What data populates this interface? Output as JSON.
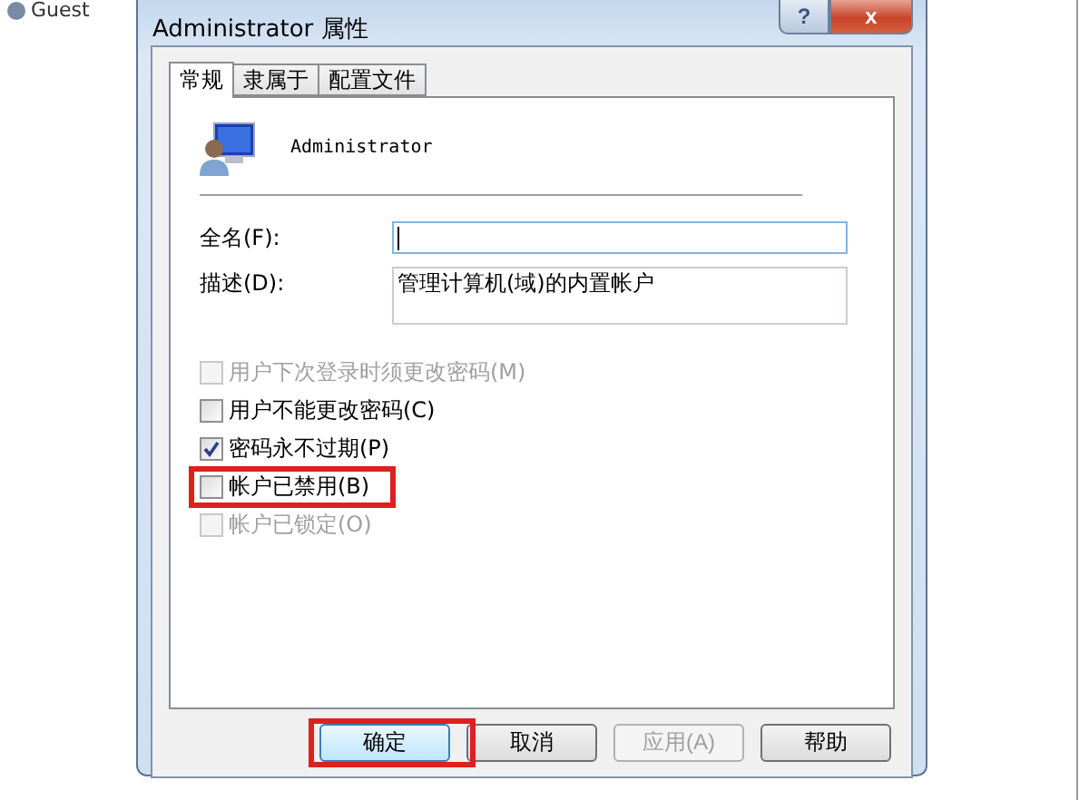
{
  "background_list": {
    "item": "Guest"
  },
  "window": {
    "title": "Administrator 属性",
    "help_button": "?",
    "close_button": "x"
  },
  "tabs": [
    {
      "label": "常规",
      "selected": true
    },
    {
      "label": "隶属于",
      "selected": false
    },
    {
      "label": "配置文件",
      "selected": false
    }
  ],
  "user": {
    "name": "Administrator"
  },
  "fields": [
    {
      "label": "全名(F):",
      "multiline": false
    },
    {
      "label": "描述(D):",
      "value": "管理计算机(域)的内置帐户",
      "multiline": true
    }
  ],
  "checkboxes": [
    {
      "label": "用户下次登录时须更改密码(M)",
      "checked": false,
      "disabled": true,
      "highlighted": false
    },
    {
      "label": "用户不能更改密码(C)",
      "checked": false,
      "disabled": false,
      "highlighted": false
    },
    {
      "label": "密码永不过期(P)",
      "checked": true,
      "disabled": false,
      "highlighted": false
    },
    {
      "label": "帐户已禁用(B)",
      "checked": false,
      "disabled": false,
      "highlighted": true
    },
    {
      "label": "帐户已锁定(O)",
      "checked": false,
      "disabled": true,
      "highlighted": false
    }
  ],
  "buttons": [
    {
      "label": "确定",
      "default": true,
      "disabled": false,
      "highlighted": true
    },
    {
      "label": "取消",
      "default": false,
      "disabled": false,
      "highlighted": false
    },
    {
      "label": "应用(A)",
      "default": false,
      "disabled": true,
      "highlighted": false
    },
    {
      "label": "帮助",
      "default": false,
      "disabled": false,
      "highlighted": false
    }
  ]
}
